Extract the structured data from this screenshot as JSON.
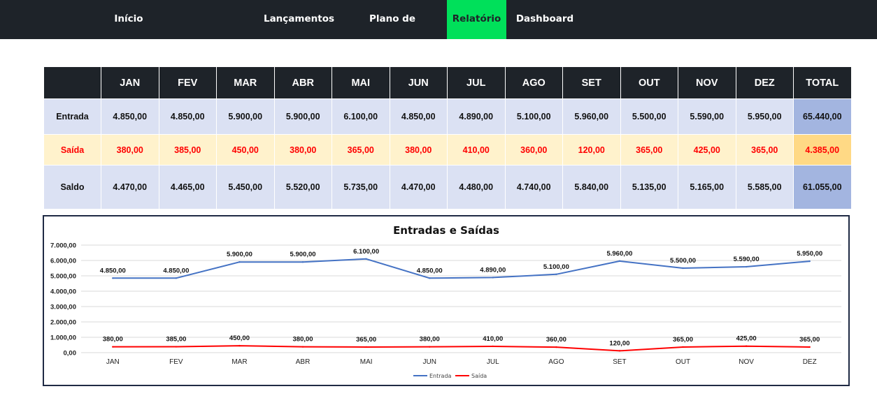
{
  "nav": {
    "items": [
      {
        "label": "Início",
        "name": "nav-inicio"
      },
      {
        "label": "Lançamentos",
        "name": "nav-lancamentos"
      },
      {
        "label": "Plano de Contas",
        "name": "nav-plano-de-contas"
      },
      {
        "label": "Relatório",
        "name": "nav-relatorio",
        "active": true
      },
      {
        "label": "Dashboard",
        "name": "nav-dashboard"
      }
    ],
    "active_color": "#00e05a"
  },
  "table": {
    "headers": [
      "JAN",
      "FEV",
      "MAR",
      "ABR",
      "MAI",
      "JUN",
      "JUL",
      "AGO",
      "SET",
      "OUT",
      "NOV",
      "DEZ",
      "TOTAL"
    ],
    "rows": {
      "entrada": {
        "label": "Entrada",
        "values": [
          "4.850,00",
          "4.850,00",
          "5.900,00",
          "5.900,00",
          "6.100,00",
          "4.850,00",
          "4.890,00",
          "5.100,00",
          "5.960,00",
          "5.500,00",
          "5.590,00",
          "5.950,00"
        ],
        "total": "65.440,00"
      },
      "saida": {
        "label": "Saída",
        "values": [
          "380,00",
          "385,00",
          "450,00",
          "380,00",
          "365,00",
          "380,00",
          "410,00",
          "360,00",
          "120,00",
          "365,00",
          "425,00",
          "365,00"
        ],
        "total": "4.385,00"
      },
      "saldo": {
        "label": "Saldo",
        "values": [
          "4.470,00",
          "4.465,00",
          "5.450,00",
          "5.520,00",
          "5.735,00",
          "4.470,00",
          "4.480,00",
          "4.740,00",
          "5.840,00",
          "5.135,00",
          "5.165,00",
          "5.585,00"
        ],
        "total": "61.055,00"
      }
    }
  },
  "chart_data": {
    "type": "line",
    "title": "Entradas e Saídas",
    "categories": [
      "JAN",
      "FEV",
      "MAR",
      "ABR",
      "MAI",
      "JUN",
      "JUL",
      "AGO",
      "SET",
      "OUT",
      "NOV",
      "DEZ"
    ],
    "ylim": [
      0,
      7000
    ],
    "yticks": [
      0,
      1000,
      2000,
      3000,
      4000,
      5000,
      6000,
      7000
    ],
    "ytick_labels": [
      "0,00",
      "1.000,00",
      "2.000,00",
      "3.000,00",
      "4.000,00",
      "5.000,00",
      "6.000,00",
      "7.000,00"
    ],
    "grid": true,
    "legend_position": "bottom",
    "series": [
      {
        "name": "Entrada",
        "color": "#4472c4",
        "values": [
          4850,
          4850,
          5900,
          5900,
          6100,
          4850,
          4890,
          5100,
          5960,
          5500,
          5590,
          5950
        ],
        "labels": [
          "4.850,00",
          "4.850,00",
          "5.900,00",
          "5.900,00",
          "6.100,00",
          "4.850,00",
          "4.890,00",
          "5.100,00",
          "5.960,00",
          "5.500,00",
          "5.590,00",
          "5.950,00"
        ]
      },
      {
        "name": "Saída",
        "color": "#ff0000",
        "values": [
          380,
          385,
          450,
          380,
          365,
          380,
          410,
          360,
          120,
          365,
          425,
          365
        ],
        "labels": [
          "380,00",
          "385,00",
          "450,00",
          "380,00",
          "365,00",
          "380,00",
          "410,00",
          "360,00",
          "120,00",
          "365,00",
          "425,00",
          "365,00"
        ]
      }
    ]
  }
}
